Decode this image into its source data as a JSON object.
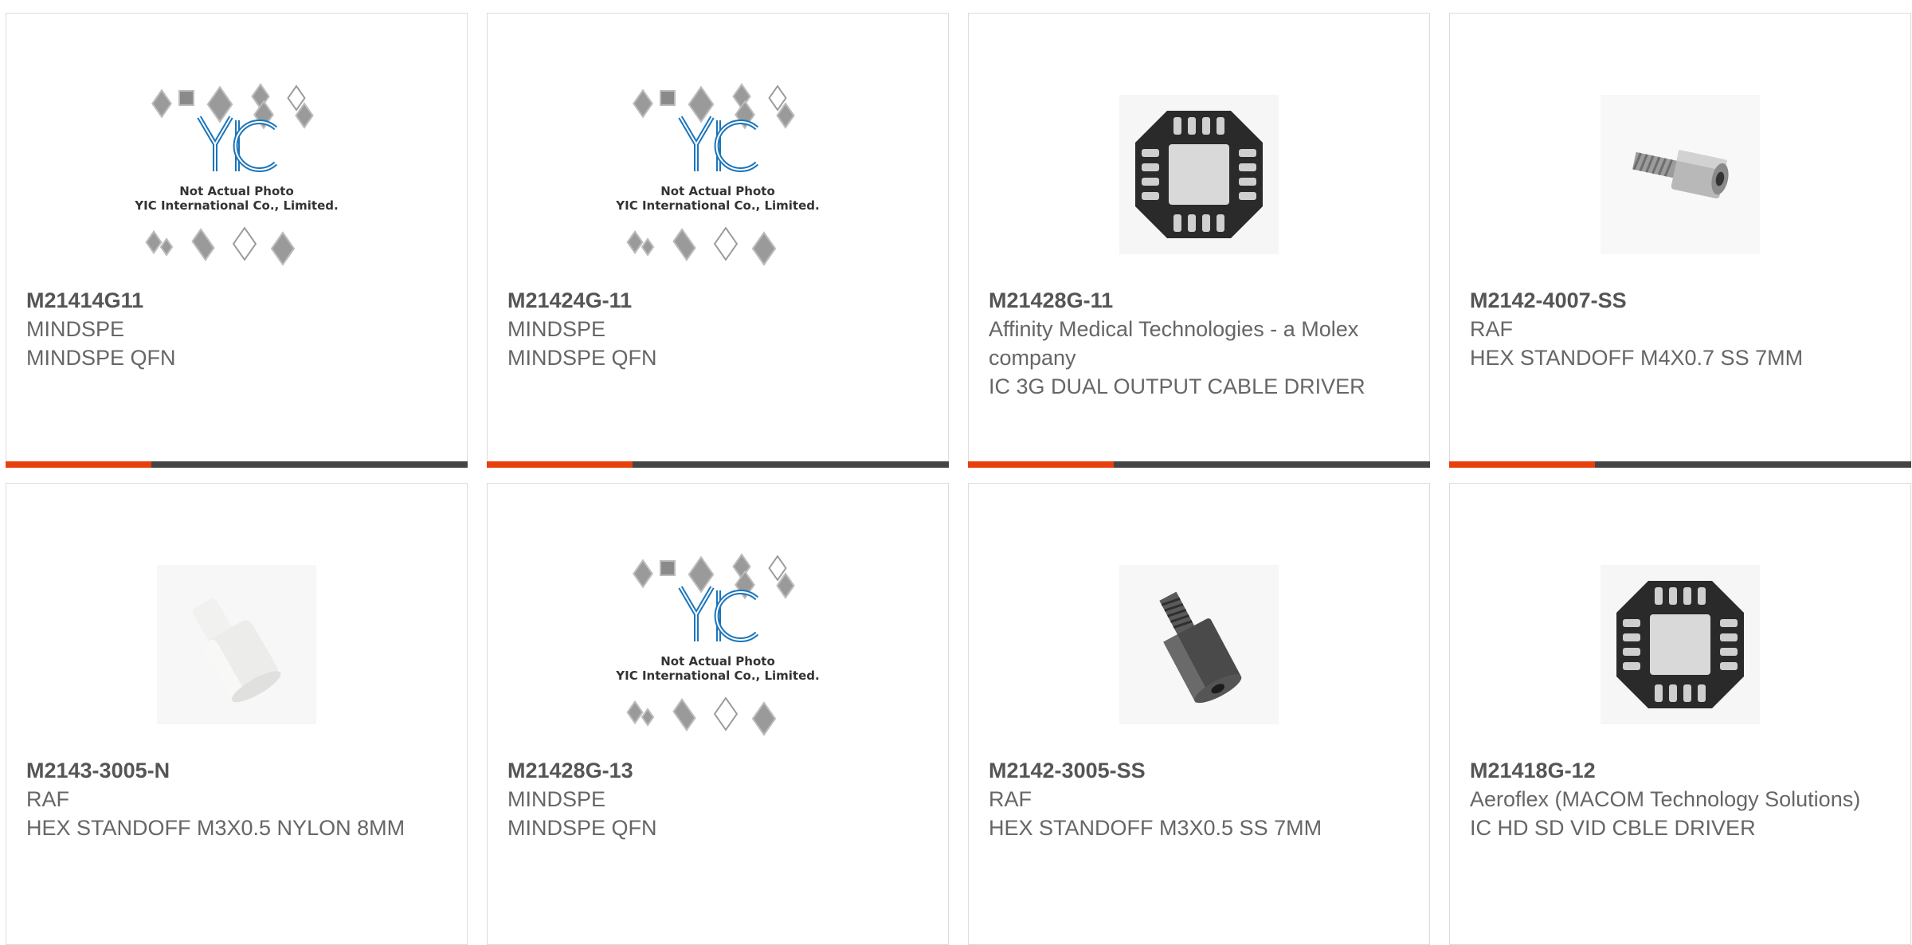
{
  "placeholder": {
    "line1": "Not Actual Photo",
    "line2": "YIC International Co., Limited."
  },
  "products": [
    {
      "part": "M21414G11",
      "manufacturer": "MINDSPE",
      "description": "MINDSPE QFN",
      "image": "placeholder"
    },
    {
      "part": "M21424G-11",
      "manufacturer": "MINDSPE",
      "description": "MINDSPE QFN",
      "image": "placeholder"
    },
    {
      "part": "M21428G-11",
      "manufacturer": "Affinity Medical Technologies - a Molex company",
      "description": "IC 3G DUAL OUTPUT CABLE DRIVER",
      "image": "qfn-chip"
    },
    {
      "part": "M2142-4007-SS",
      "manufacturer": "RAF",
      "description": "HEX STANDOFF M4X0.7 SS 7MM",
      "image": "steel-standoff"
    },
    {
      "part": "M2143-3005-N",
      "manufacturer": "RAF",
      "description": "HEX STANDOFF M3X0.5 NYLON 8MM",
      "image": "nylon-standoff"
    },
    {
      "part": "M21428G-13",
      "manufacturer": "MINDSPE",
      "description": "MINDSPE QFN",
      "image": "placeholder"
    },
    {
      "part": "M2142-3005-SS",
      "manufacturer": "RAF",
      "description": "HEX STANDOFF M3X0.5 SS 7MM",
      "image": "dark-standoff"
    },
    {
      "part": "M21418G-12",
      "manufacturer": "Aeroflex (MACOM Technology Solutions)",
      "description": "IC HD SD VID CBLE DRIVER",
      "image": "qfn-chip"
    }
  ],
  "colors": {
    "accent": "#e8400d",
    "bar": "#444444",
    "text": "#666666"
  }
}
